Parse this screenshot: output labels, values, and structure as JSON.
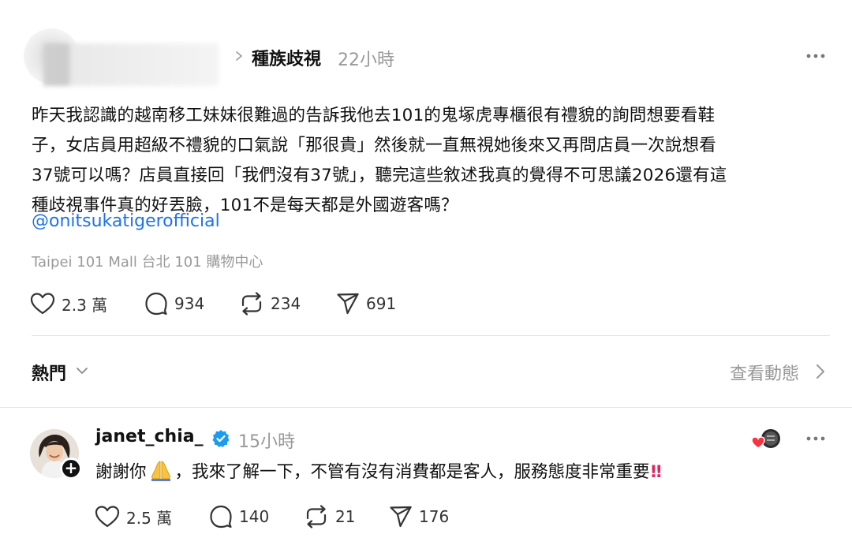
{
  "post": {
    "topic": "種族歧視",
    "time": "22小時",
    "body_lines": [
      "昨天我認識的越南移工妹妹很難過的告訴我他去101的鬼塚虎專櫃很有禮貌的詢問想要看鞋",
      "子，女店員用超級不禮貌的口氣說「那很貴」然後就一直無視她後來又再問店員一次說想看",
      "37號可以嗎？店員直接回「我們沒有37號」，聽完這些敘述我真的覺得不可思議2026還有這",
      "種歧視事件真的好丟臉，101不是每天都是外國遊客嗎？"
    ],
    "mention": "@onitsukatigerofficial",
    "location": "Taipei 101 Mall 台北 101 購物中心",
    "likes": "2.3 萬",
    "comments": "934",
    "reposts": "234",
    "shares": "691"
  },
  "replies_bar": {
    "sort_label": "熱門",
    "view_activity": "查看動態"
  },
  "reply": {
    "username": "janet_chia_",
    "time": "15小時",
    "text_before": "謝謝你",
    "text_after": "，我來了解一下，不管有沒有消費都是客人，服務態度非常重要",
    "emphasis": "!!",
    "likes": "2.5 萬",
    "comments": "140",
    "reposts": "21",
    "shares": "176"
  },
  "colors": {
    "link": "#1d73e8",
    "muted": "#999999",
    "verified": "#1d9bf0",
    "alert": "#e0245e"
  },
  "icons": [
    "heart-icon",
    "comment-icon",
    "repost-icon",
    "share-icon",
    "more-icon",
    "chevron-down-icon",
    "chevron-right-icon",
    "verified-icon",
    "pray-emoji-icon",
    "plus-icon"
  ]
}
